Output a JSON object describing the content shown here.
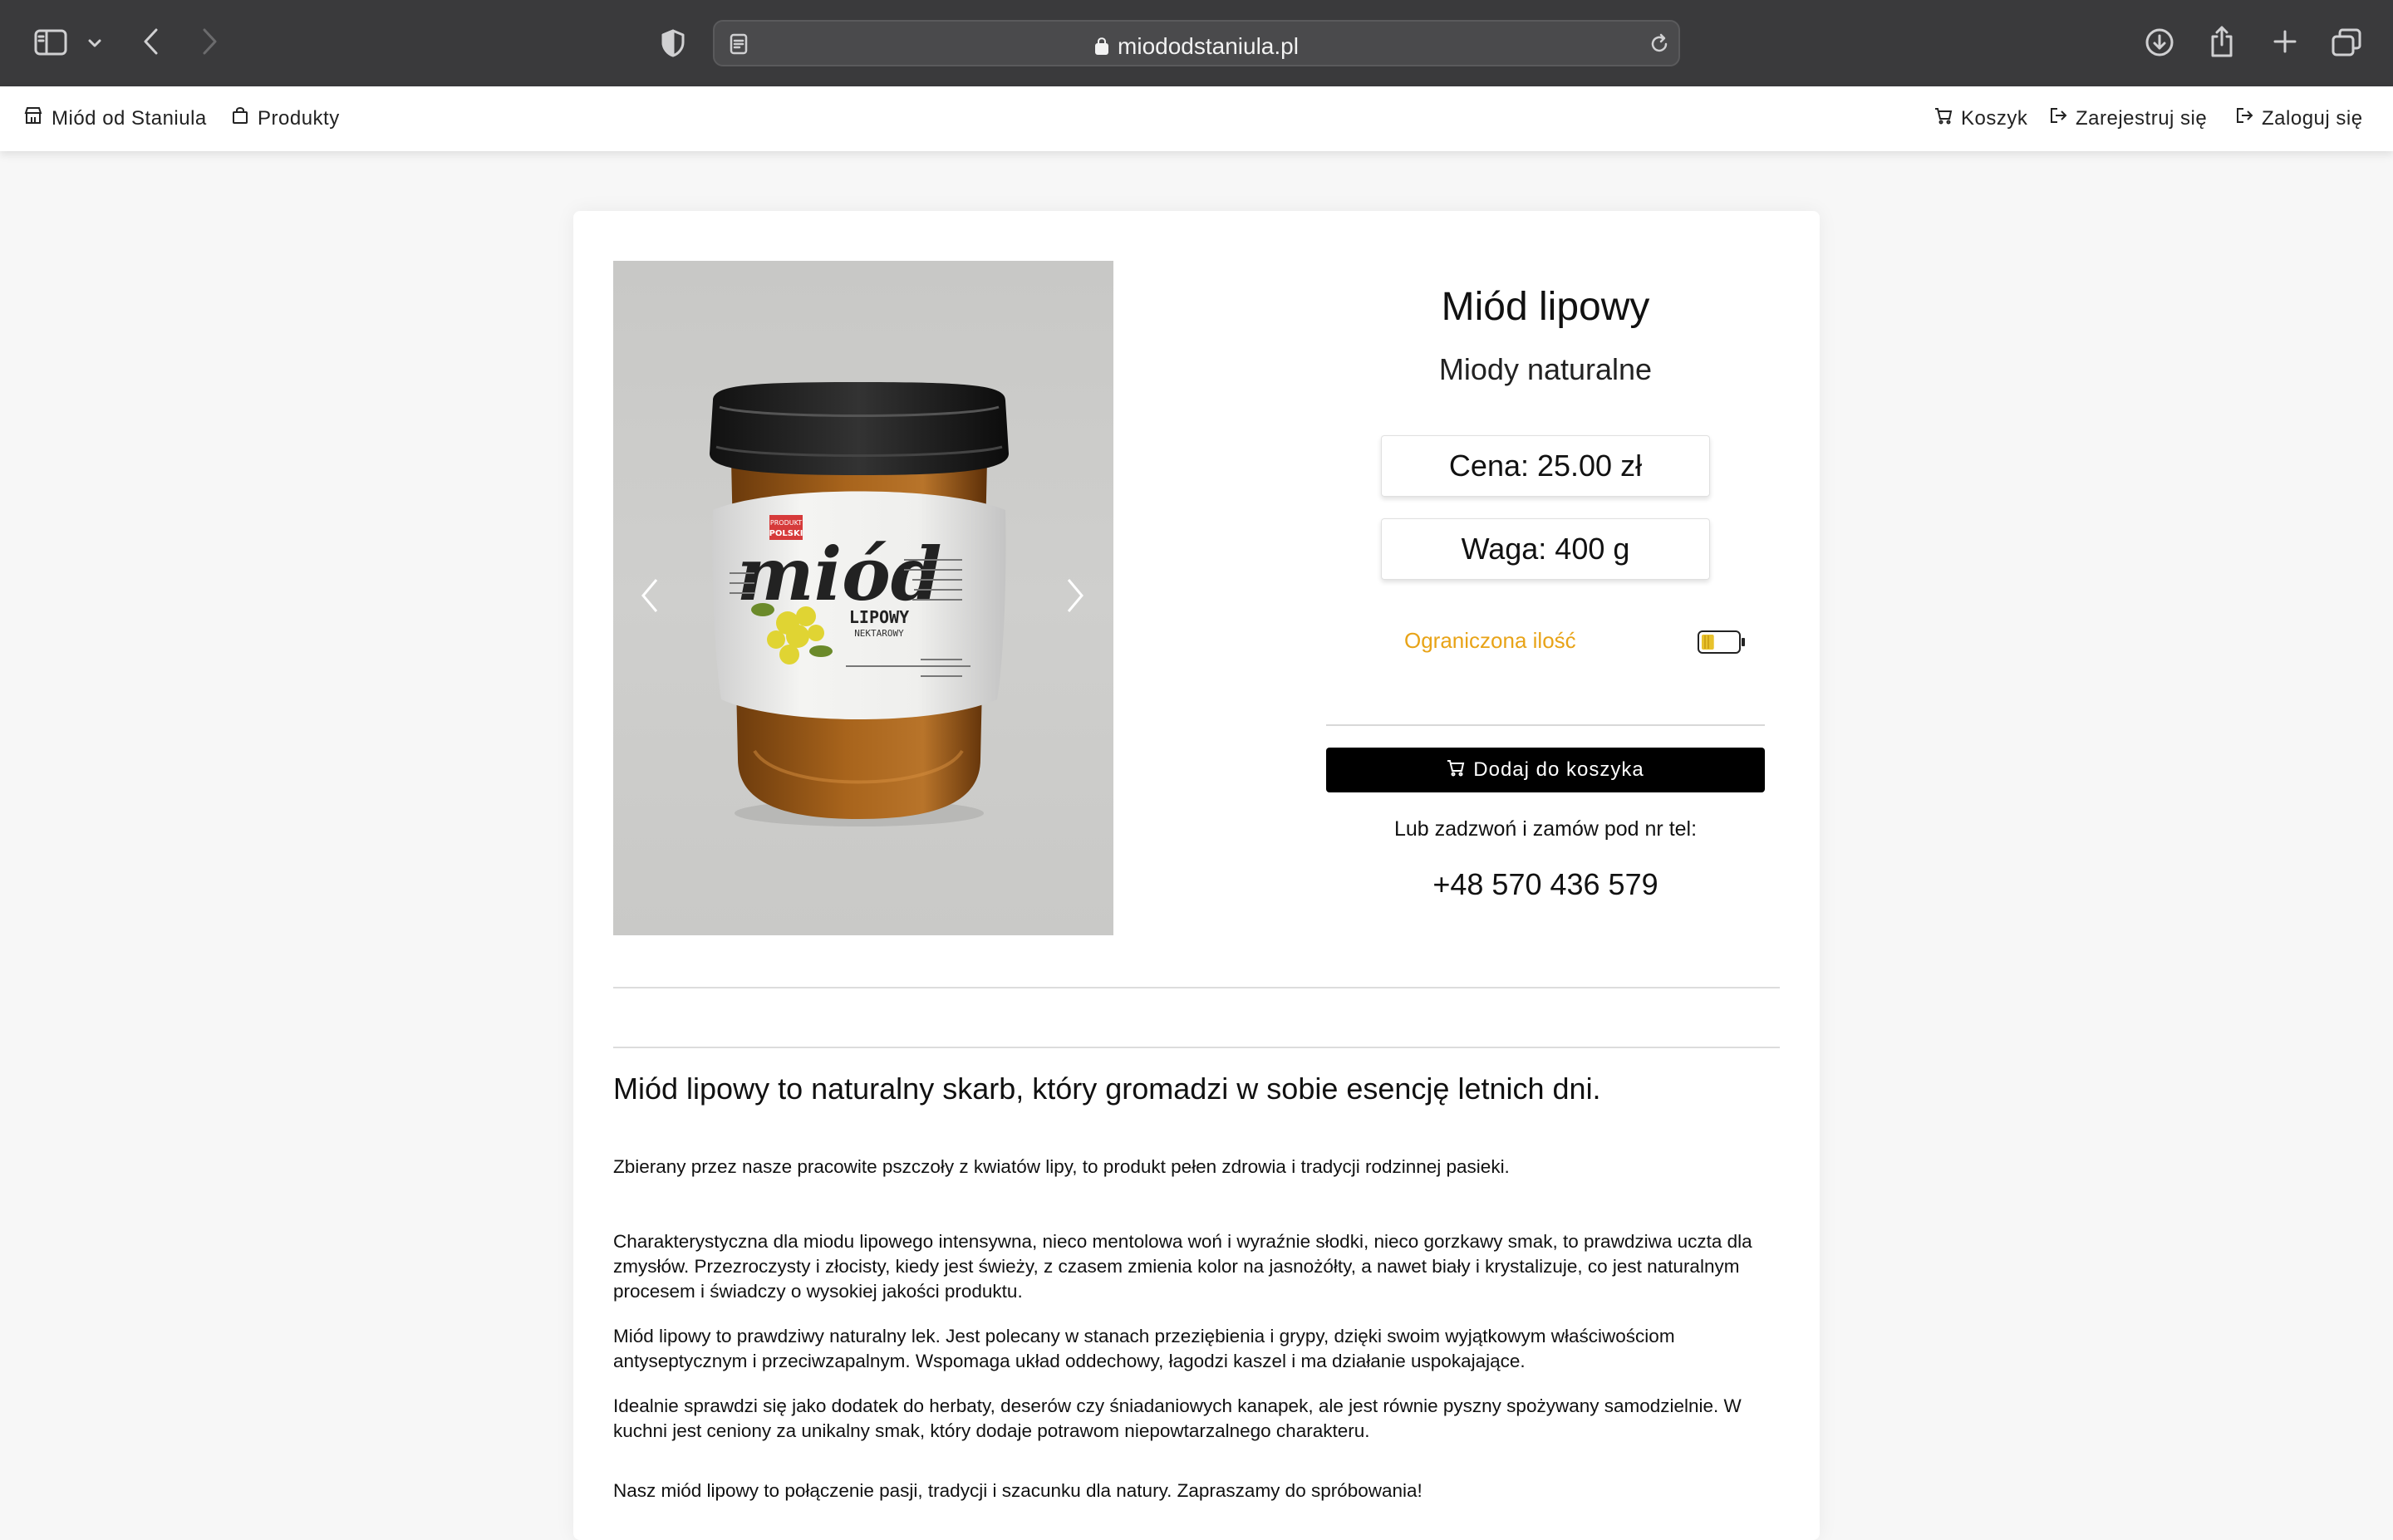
{
  "browser": {
    "url": "miododstaniula.pl"
  },
  "nav": {
    "brand": "Miód od Staniula",
    "products": "Produkty",
    "cart": "Koszyk",
    "register": "Zarejestruj się",
    "login": "Zaloguj się"
  },
  "product": {
    "title": "Miód lipowy",
    "category": "Miody naturalne",
    "price": "Cena: 25.00 zł",
    "weight": "Waga: 400 g",
    "stock_status": "Ograniczona ilość",
    "stock_level": 0.35,
    "add_to_cart": "Dodaj do koszyka",
    "call_text": "Lub zadzwoń i zamów pod nr tel:",
    "phone": "+48 570 436 579"
  },
  "jar_label": {
    "badge_top": "PRODUKT",
    "badge_bottom": "POLSKI",
    "word": "miód",
    "variety": "LIPOWY",
    "type": "NEKTAROWY"
  },
  "description": {
    "heading": "Miód lipowy to naturalny skarb, który gromadzi w sobie esencję letnich dni.",
    "p1": "Zbierany przez nasze pracowite pszczoły z kwiatów lipy, to produkt pełen zdrowia i tradycji rodzinnej pasieki.",
    "p2": "Charakterystyczna dla miodu lipowego intensywna, nieco mentolowa woń i wyraźnie słodki, nieco gorzkawy smak, to prawdziwa uczta dla zmysłów. Przezroczysty i złocisty, kiedy jest świeży, z czasem zmienia kolor na jasnożółty, a nawet biały i krystalizuje, co jest naturalnym procesem i świadczy o wysokiej jakości produktu.",
    "p3": "Miód lipowy to prawdziwy naturalny lek. Jest polecany w stanach przeziębienia i grypy, dzięki swoim wyjątkowym właściwościom antyseptycznym i przeciwzapalnym. Wspomaga układ oddechowy, łagodzi kaszel i ma działanie uspokajające.",
    "p4": "Idealnie sprawdzi się jako dodatek do herbaty, deserów czy śniadaniowych kanapek, ale jest równie pyszny spożywany samodzielnie. W kuchni jest ceniony za unikalny smak, który dodaje potrawom niepowtarzalnego charakteru.",
    "p5": "Nasz miód lipowy to połączenie pasji, tradycji i szacunku dla natury. Zapraszamy do spróbowania!"
  }
}
